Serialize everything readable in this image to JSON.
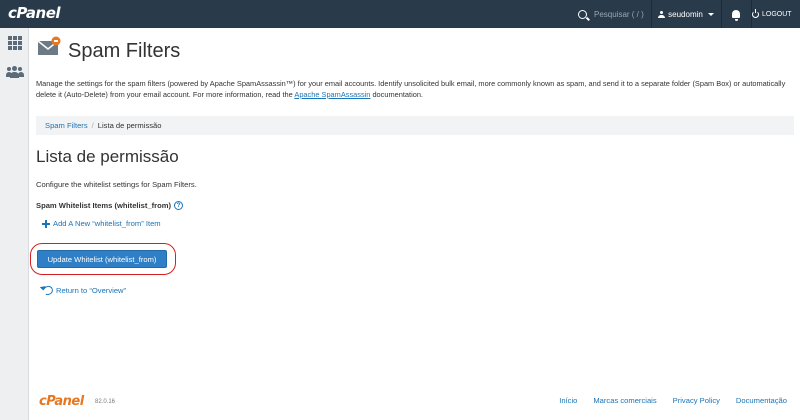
{
  "topbar": {
    "logo": "cPanel",
    "search_placeholder": "Pesquisar ( / )",
    "username": "seudomin",
    "logout_label": "LOGOUT"
  },
  "page": {
    "title": "Spam Filters",
    "description_prefix": "Manage the settings for the spam filters (powered by Apache SpamAssassin™) for your email accounts. Identify unsolicited bulk email, more commonly known as spam, and send it to a separate folder (Spam Box) or automatically delete it (Auto-Delete) from your email account. For more information, read the ",
    "description_link": "Apache SpamAssassin",
    "description_suffix": " documentation."
  },
  "breadcrumb": {
    "parent": "Spam Filters",
    "separator": "/",
    "current": "Lista de permissão"
  },
  "content": {
    "heading": "Lista de permissão",
    "configure_text": "Configure the whitelist settings for Spam Filters.",
    "items_label": "Spam Whitelist Items (whitelist_from)",
    "help_glyph": "?",
    "add_link": "Add A New “whitelist_from” Item",
    "update_button": "Update Whitelist (whitelist_from)",
    "return_link": "Return to “Overview”"
  },
  "footer": {
    "logo": "cPanel",
    "version": "82.0.16",
    "links": [
      "Início",
      "Marcas comerciais",
      "Privacy Policy",
      "Documentação"
    ]
  },
  "colors": {
    "topbar": "#293a4a",
    "link": "#1a74b8",
    "button": "#2f7fc7",
    "highlight_ring": "#d42020",
    "brand_orange": "#e87722"
  },
  "icons": [
    "search-icon",
    "user-icon",
    "bell-icon",
    "logout-icon",
    "grid-icon",
    "users-icon",
    "mail-settings-icon",
    "help-icon",
    "plus-icon",
    "undo-icon"
  ]
}
